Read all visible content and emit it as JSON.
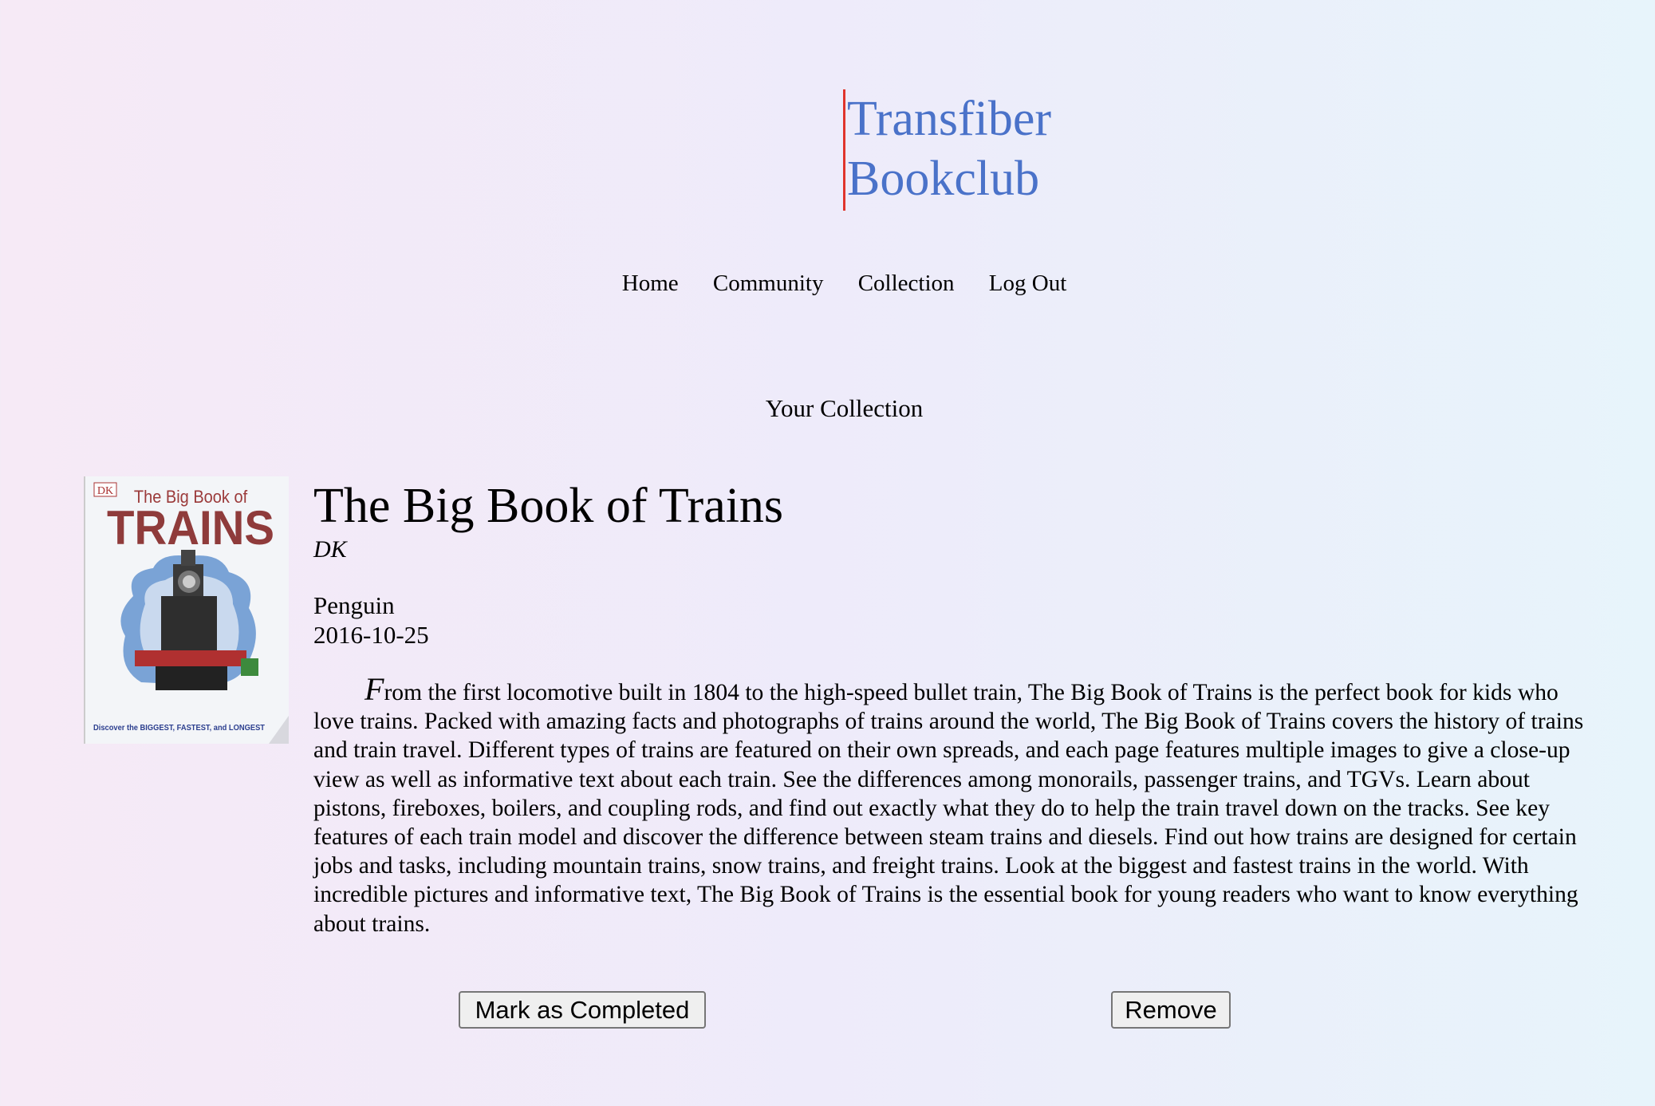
{
  "header": {
    "logo_line1": "Transfiber",
    "logo_line2": "Bookclub",
    "accent_colors": {
      "logo_text": "#4a72c9",
      "logo_bar": "#e0342c"
    }
  },
  "nav": {
    "items": [
      {
        "label": "Home"
      },
      {
        "label": "Community"
      },
      {
        "label": "Collection"
      },
      {
        "label": "Log Out"
      }
    ]
  },
  "page": {
    "heading": "Your Collection"
  },
  "book": {
    "cover": {
      "publisher_mark": "DK",
      "title_small": "The Big Book of",
      "title_large": "TRAINS",
      "tagline": "Discover the BIGGEST, FASTEST, and LONGEST"
    },
    "title": "The Big Book of Trains",
    "author": "DK",
    "publisher": "Penguin",
    "date": "2016-10-25",
    "description": "From the first locomotive built in 1804 to the high-speed bullet train, The Big Book of Trains is the perfect book for kids who love trains. Packed with amazing facts and photographs of trains around the world, The Big Book of Trains covers the history of trains and train travel. Different types of trains are featured on their own spreads, and each page features multiple images to give a close-up view as well as informative text about each train. See the differences among monorails, passenger trains, and TGVs. Learn about pistons, fireboxes, boilers, and coupling rods, and find out exactly what they do to help the train travel down on the tracks. See key features of each train model and discover the difference between steam trains and diesels. Find out how trains are designed for certain jobs and tasks, including mountain trains, snow trains, and freight trains. Look at the biggest and fastest trains in the world. With incredible pictures and informative text, The Big Book of Trains is the essential book for young readers who want to know everything about trains."
  },
  "actions": {
    "complete_label": "Mark as Completed",
    "remove_label": "Remove"
  }
}
